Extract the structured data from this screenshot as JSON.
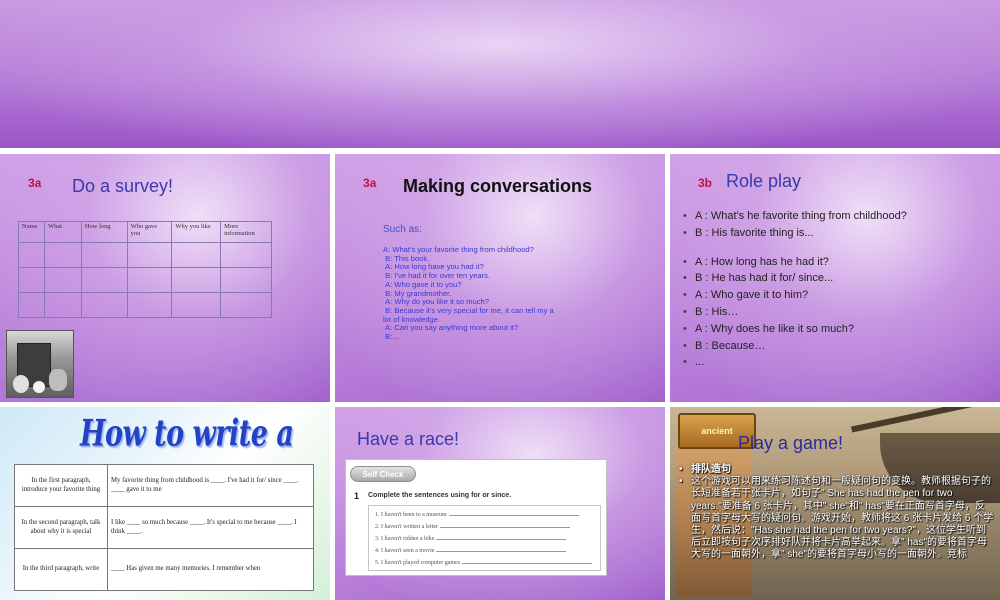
{
  "slide1": {
    "tag": "3a",
    "title": "Do a survey!",
    "table_headers": [
      "Name",
      "What",
      "How long",
      "Who gave you",
      "Why you like",
      "More information"
    ],
    "table_rows": 3
  },
  "slide2": {
    "tag": "3a",
    "title": "Making conversations",
    "such_as": "Such as:",
    "dialog": [
      "A: What's your favorite thing from childhood?",
      " B: This book.",
      " A: How long have you had it?",
      " B: I've had it for over ten years.",
      " A: Who gave it to you?",
      " B: My grandmother.",
      " A: Why do you like it so much?",
      " B: Because it's very special for me, it can tell my a lot of knowledge.",
      " A: Can you say anything more about it?",
      " B:..."
    ]
  },
  "slide3": {
    "tag": "3b",
    "title": "Role play",
    "bullets": [
      "A : What's he favorite thing from childhood?",
      "B : His favorite thing is...",
      "A : How long has he had it?",
      "B : He has had it for/ since...",
      "A : Who gave it to him?",
      "B : His…",
      "A : Why does he like it so much?",
      "B : Because…",
      "..."
    ]
  },
  "slide4": {
    "title": "How to write a passage",
    "rows": [
      {
        "left": "In the first paragraph, introduce your favorite thing",
        "right": "My favorite thing from childhood is ____. I've had it for/ since ____. ____ gave it to me"
      },
      {
        "left": "In the second paragraph, talk about why it is special",
        "right": "I like ____ so much because ____. It's special to me because ____. I think ____."
      },
      {
        "left": "In the third paragraph, write",
        "right": "____ Has given me many memories. I remember when"
      }
    ]
  },
  "slide5": {
    "title": "Have a race!",
    "badge": "Self Check",
    "instruction_number": "1",
    "instruction": "Complete the sentences using for or since.",
    "sentences": [
      "1. I haven't been to a museum",
      "2. I haven't written a letter",
      "3. I haven't ridden a bike",
      "4. I haven't seen a movie",
      "5. I haven't played computer games"
    ]
  },
  "slide6": {
    "title": "Play a game!",
    "sign": "ancient",
    "bullets": [
      "排队造句",
      "这个游戏可以用来练习陈述句和一般疑问句的变换。教师根据句子的长短准备若干张卡片，如句子\" She has had the pen for two years.\"要准备 6 张卡片，其中\" she\"和\" has\"要在正面写首字母，反面写首字母大写的疑问句。游戏开始，教师将这 6 张卡片发给 6 个学生，然后说：\"Has she had the pen for two years?\"，这位学生听到后立即按句子次序排好队并将卡片高举起来。拿\" has\"的要将首字母大写的一面朝外，拿\" she\"的要将首字母小写的一面朝外。竞标"
    ]
  }
}
